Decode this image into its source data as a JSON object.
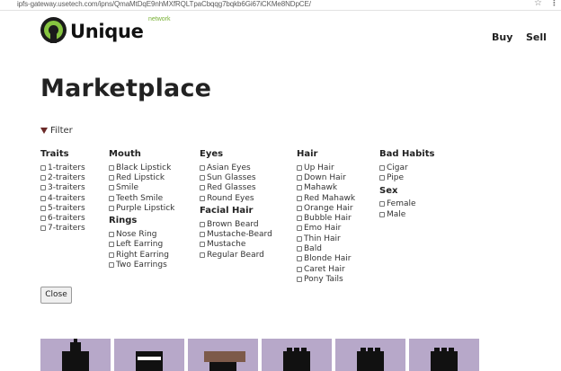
{
  "browser": {
    "url": "ipfs-gateway.usetech.com/ipns/QmaMtDqE9nhMXfRQLTpaCbqqg7bqkb6Gi67iCKMe8NDpCE/"
  },
  "header": {
    "logo_text": "Unique",
    "logo_network": "network",
    "nav": [
      "Buy",
      "Sell"
    ]
  },
  "page_title": "Marketplace",
  "filter": {
    "toggle_label": "Filter",
    "columns": [
      {
        "groups": [
          {
            "title": "Traits",
            "options": [
              "1-traiters",
              "2-traiters",
              "3-traiters",
              "4-traiters",
              "5-traiters",
              "6-traiters",
              "7-traiters"
            ]
          }
        ]
      },
      {
        "groups": [
          {
            "title": "Mouth",
            "options": [
              "Black Lipstick",
              "Red Lipstick",
              "Smile",
              "Teeth Smile",
              "Purple Lipstick"
            ]
          },
          {
            "title": "Rings",
            "options": [
              "Nose Ring",
              "Left Earring",
              "Right Earring",
              "Two Earrings"
            ]
          }
        ]
      },
      {
        "groups": [
          {
            "title": "Eyes",
            "options": [
              "Asian Eyes",
              "Sun Glasses",
              "Red Glasses",
              "Round Eyes"
            ]
          },
          {
            "title": "Facial Hair",
            "options": [
              "Brown Beard",
              "Mustache-Beard",
              "Mustache",
              "Regular Beard"
            ]
          }
        ]
      },
      {
        "groups": [
          {
            "title": "Hair",
            "options": [
              "Up Hair",
              "Down Hair",
              "Mahawk",
              "Red Mahawk",
              "Orange Hair",
              "Bubble Hair",
              "Emo Hair",
              "Thin Hair",
              "Bald",
              "Blonde Hair",
              "Caret Hair",
              "Pony Tails"
            ]
          }
        ]
      },
      {
        "groups": [
          {
            "title": "Bad Habits",
            "options": [
              "Cigar",
              "Pipe"
            ]
          },
          {
            "title": "Sex",
            "options": [
              "Female",
              "Male"
            ]
          }
        ]
      }
    ],
    "close_label": "Close"
  },
  "cards": [
    {
      "style": "hat"
    },
    {
      "style": "band"
    },
    {
      "style": "mahawk"
    },
    {
      "style": "head"
    },
    {
      "style": "head"
    },
    {
      "style": "head"
    }
  ],
  "colors": {
    "accent_green": "#86c440",
    "card_bg": "#b7a8c9",
    "filter_triangle": "#6b2a28"
  }
}
